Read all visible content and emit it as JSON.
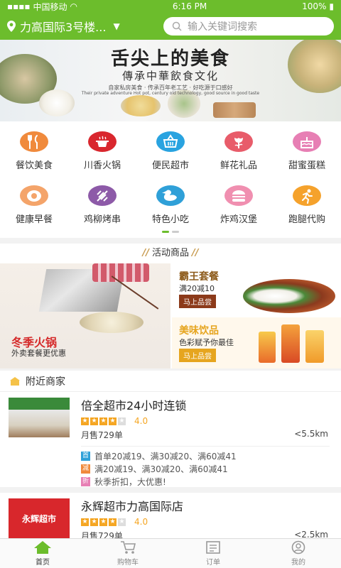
{
  "status_bar": {
    "carrier": "中国移动",
    "time": "6:16 PM",
    "battery": "100%"
  },
  "header": {
    "location": "力高国际3号楼...",
    "search_placeholder": "输入关键词搜索"
  },
  "banner": {
    "title": "舌尖上的美食",
    "subtitle": "傳承中華飲食文化",
    "caption_cn": "自家私房美食 · 传承百年老工艺 · 好吃源于口感好",
    "caption_en": "Their private adventure Hot pot, century old technology, good source in good taste"
  },
  "categories": [
    {
      "label": "餐饮美食",
      "icon": "fork-knife-icon",
      "color": "#f08a3c"
    },
    {
      "label": "川香火锅",
      "icon": "hotpot-icon",
      "color": "#d9272e"
    },
    {
      "label": "便民超市",
      "icon": "basket-icon",
      "color": "#29a3e0"
    },
    {
      "label": "鲜花礼品",
      "icon": "flower-icon",
      "color": "#e85c6a"
    },
    {
      "label": "甜蜜蛋糕",
      "icon": "cake-icon",
      "color": "#e77fb4"
    },
    {
      "label": "健康早餐",
      "icon": "egg-icon",
      "color": "#f4a46a"
    },
    {
      "label": "鸡柳烤串",
      "icon": "skewer-icon",
      "color": "#8d5aa8"
    },
    {
      "label": "特色小吃",
      "icon": "duck-icon",
      "color": "#2fa0d8"
    },
    {
      "label": "炸鸡汉堡",
      "icon": "burger-icon",
      "color": "#f08fb0"
    },
    {
      "label": "跑腿代购",
      "icon": "runner-icon",
      "color": "#f5a22c"
    }
  ],
  "activity": {
    "title": "活动商品",
    "left_title": "冬季火锅",
    "left_sub": "外卖套餐更优惠",
    "rt_title": "霸王套餐",
    "rt_sub": "满20减10",
    "rt_button": "马上品尝",
    "rb_title": "美味饮品",
    "rb_sub": "色彩赋予你最佳",
    "rb_button": "马上品尝"
  },
  "nearby": {
    "title": "附近商家",
    "shops": [
      {
        "name": "倍全超市24小时连锁",
        "rating": 4,
        "score": "4.0",
        "sales": "月售729单",
        "distance": "<5.5km",
        "promos": [
          {
            "tag": "首",
            "color": "#2fa0d8",
            "text": "首单20减19、满30减20、满60减41"
          },
          {
            "tag": "减",
            "color": "#f08a3c",
            "text": "满20减19、满30减20、满60减41"
          },
          {
            "tag": "折",
            "color": "#e77fb4",
            "text": "秋季折扣，大优惠!"
          }
        ]
      },
      {
        "name": "永辉超市力高国际店",
        "rating": 4,
        "score": "4.0",
        "sales": "月售729单",
        "distance": "<2.5km",
        "logo_text": "永辉超市"
      }
    ]
  },
  "nav": [
    {
      "label": "首页",
      "icon": "home-icon"
    },
    {
      "label": "购物车",
      "icon": "cart-icon"
    },
    {
      "label": "订单",
      "icon": "order-icon"
    },
    {
      "label": "我的",
      "icon": "user-icon"
    }
  ]
}
